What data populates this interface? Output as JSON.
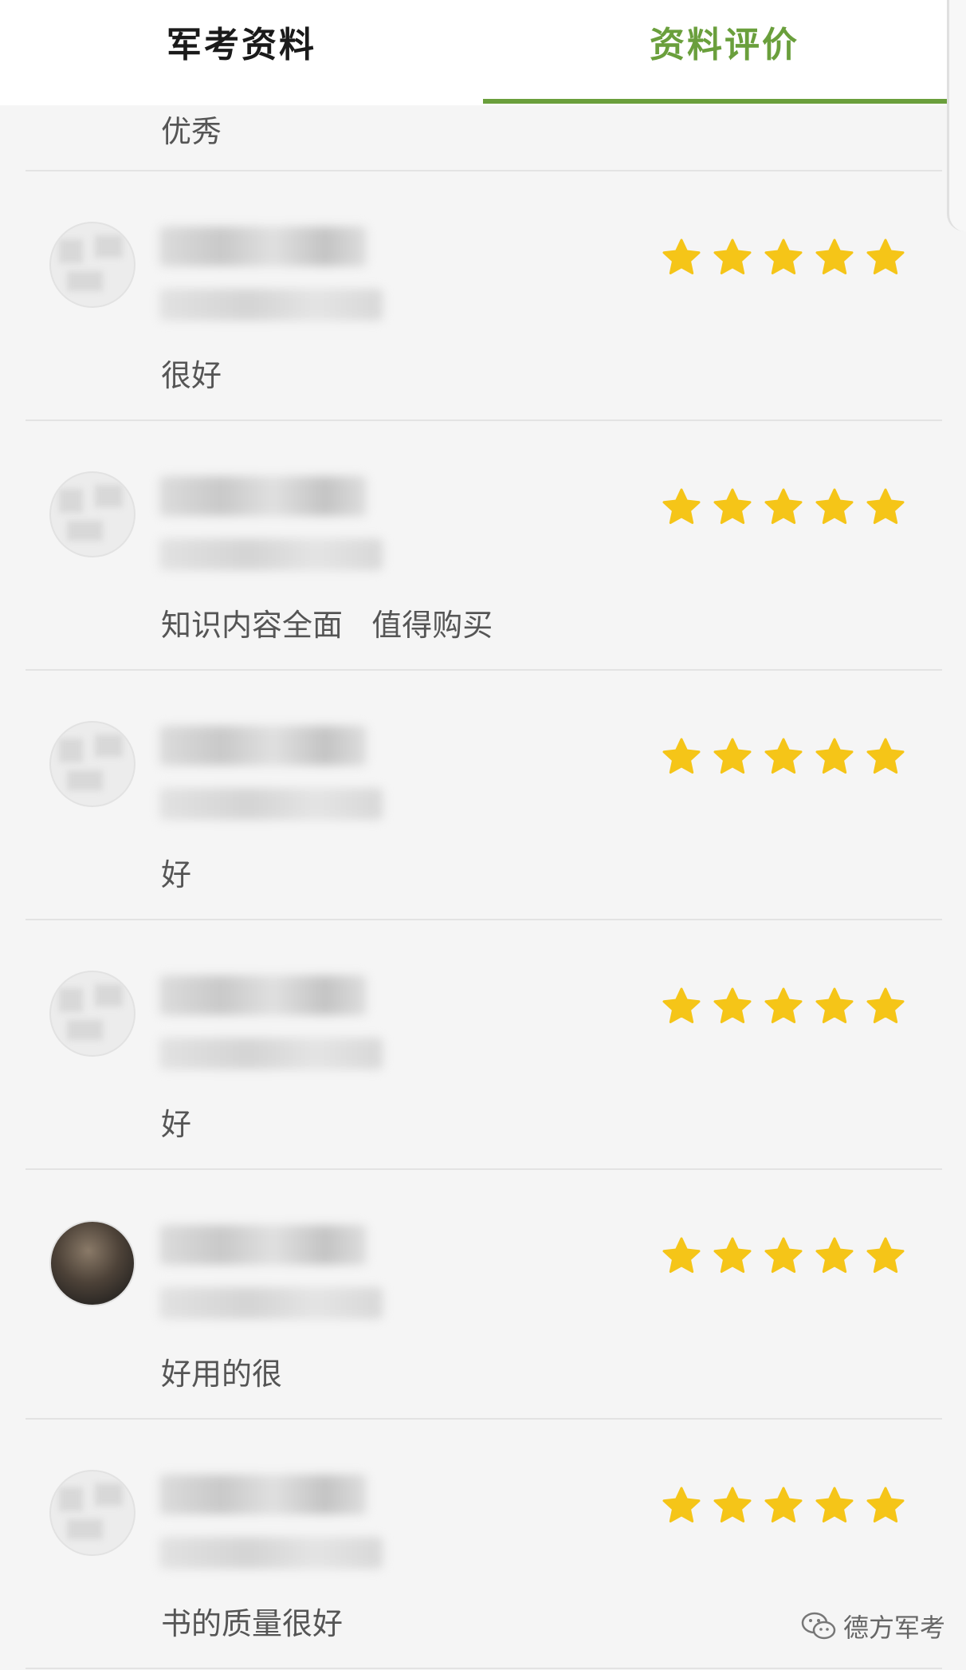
{
  "tabs": [
    {
      "label": "军考资料",
      "active": false
    },
    {
      "label": "资料评价",
      "active": true
    }
  ],
  "accent_color": "#6a9f3c",
  "star_color": "#f5c518",
  "partial_comment": "优秀",
  "reviews": [
    {
      "comment": "很好",
      "rating": 5,
      "avatar": "blurred-avatar-icon"
    },
    {
      "comment": "知识内容全面   值得购买",
      "rating": 5,
      "avatar": "blurred-avatar-icon"
    },
    {
      "comment": "好",
      "rating": 5,
      "avatar": "blurred-avatar-icon"
    },
    {
      "comment": "好",
      "rating": 5,
      "avatar": "blurred-avatar-icon"
    },
    {
      "comment": "好用的很",
      "rating": 5,
      "avatar": "photo-avatar-icon"
    },
    {
      "comment": "书的质量很好",
      "rating": 5,
      "avatar": "blurred-avatar-icon"
    }
  ],
  "watermark": {
    "text": "德方军考",
    "icon": "wechat-icon"
  }
}
